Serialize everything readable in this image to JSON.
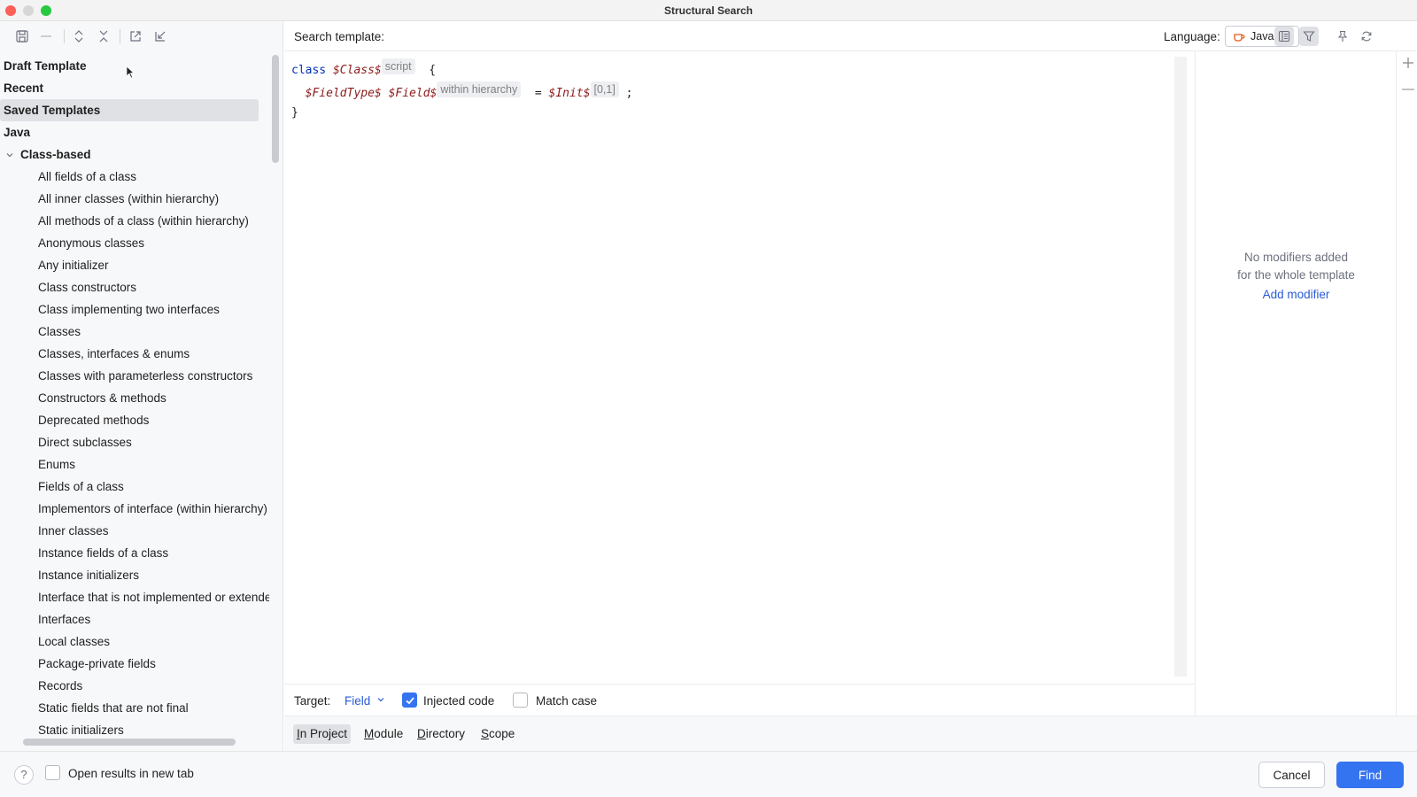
{
  "window": {
    "title": "Structural Search"
  },
  "toolbar": {
    "icons": [
      "save-icon",
      "remove-icon",
      "expand-all-icon",
      "collapse-all-icon",
      "export-icon",
      "import-icon"
    ]
  },
  "tree": {
    "top_items": [
      "Draft Template",
      "Recent",
      "Saved Templates",
      "Java"
    ],
    "selected": "Saved Templates",
    "group": "Class-based",
    "leaves": [
      "All fields of a class",
      "All inner classes (within hierarchy)",
      "All methods of a class (within hierarchy)",
      "Anonymous classes",
      "Any initializer",
      "Class constructors",
      "Class implementing two interfaces",
      "Classes",
      "Classes, interfaces & enums",
      "Classes with parameterless constructors",
      "Constructors & methods",
      "Deprecated methods",
      "Direct subclasses",
      "Enums",
      "Fields of a class",
      "Implementors of interface (within hierarchy)",
      "Inner classes",
      "Instance fields of a class",
      "Instance initializers",
      "Interface that is not implemented or extended",
      "Interfaces",
      "Local classes",
      "Package-private fields",
      "Records",
      "Static fields that are not final",
      "Static initializers"
    ]
  },
  "header": {
    "search_label": "Search template:",
    "language_label": "Language:",
    "language_value": "Java"
  },
  "code": {
    "kw_class": "class",
    "class_var": "$Class$",
    "class_hint": "script",
    "open_brace": "{",
    "field_type": "$FieldType$",
    "field_var": "$Field$",
    "field_hint": "within hierarchy",
    "equals": "=",
    "init_var": "$Init$",
    "init_hint": "[0,1]",
    "semicolon": ";",
    "close_brace": "}"
  },
  "modifiers": {
    "empty_line1": "No modifiers added",
    "empty_line2": "for the whole template",
    "add_link": "Add modifier"
  },
  "options": {
    "target_label": "Target:",
    "target_value": "Field",
    "injected_label": "Injected code",
    "injected_checked": true,
    "match_case_label": "Match case",
    "match_case_checked": false
  },
  "scope": {
    "tabs": [
      {
        "first": "I",
        "rest": "n Project",
        "active": true
      },
      {
        "first": "M",
        "rest": "odule",
        "active": false
      },
      {
        "first": "D",
        "rest": "irectory",
        "active": false
      },
      {
        "first": "S",
        "rest": "cope",
        "active": false
      }
    ]
  },
  "bottom": {
    "help": "?",
    "open_new_tab_label": "Open results in new tab",
    "cancel_label": "Cancel",
    "find_label": "Find"
  },
  "colors": {
    "accent": "#3574f0",
    "link": "#2a5bd6",
    "keyword": "#0033b3",
    "template_var": "#8c1b1b"
  }
}
